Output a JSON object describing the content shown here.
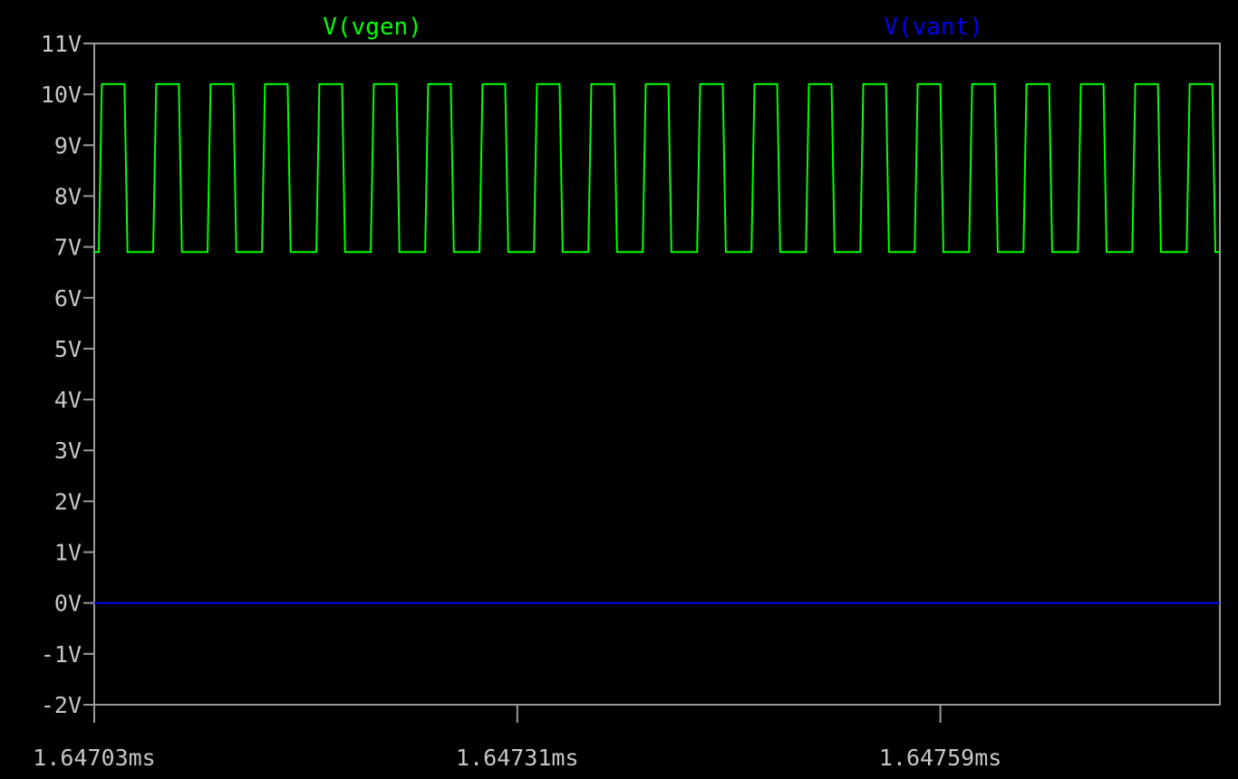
{
  "chart_data": {
    "type": "line",
    "title": "",
    "xlabel": "",
    "ylabel": "",
    "xlim": [
      1.64703,
      1.647775
    ],
    "ylim": [
      -2,
      11
    ],
    "grid": false,
    "legend": "top",
    "y_ticks": [
      11,
      10,
      9,
      8,
      7,
      6,
      5,
      4,
      3,
      2,
      1,
      0,
      -1,
      -2
    ],
    "y_tick_labels": [
      "11V",
      "10V",
      "9V",
      "8V",
      "7V",
      "6V",
      "5V",
      "4V",
      "3V",
      "2V",
      "1V",
      "0V",
      "-1V",
      "-2V"
    ],
    "x_ticks": [
      1.64703,
      1.64731,
      1.64759
    ],
    "x_tick_labels": [
      "1.64703ms",
      "1.64731ms",
      "1.64759ms"
    ],
    "series": [
      {
        "name": "V(vgen)",
        "color": "#00ff00",
        "x_start": 1.64703,
        "x_end": 1.647775,
        "period": 3.6e-05,
        "first_rise": 3e-06,
        "rise_time": 2e-06,
        "high_time": 1.5e-05,
        "fall_time": 2e-06,
        "high": 10.2,
        "low": 6.9
      },
      {
        "name": "V(vant)",
        "color": "#0000ee",
        "x": [
          1.64703,
          1.647775
        ],
        "y": [
          0,
          0
        ]
      }
    ]
  }
}
